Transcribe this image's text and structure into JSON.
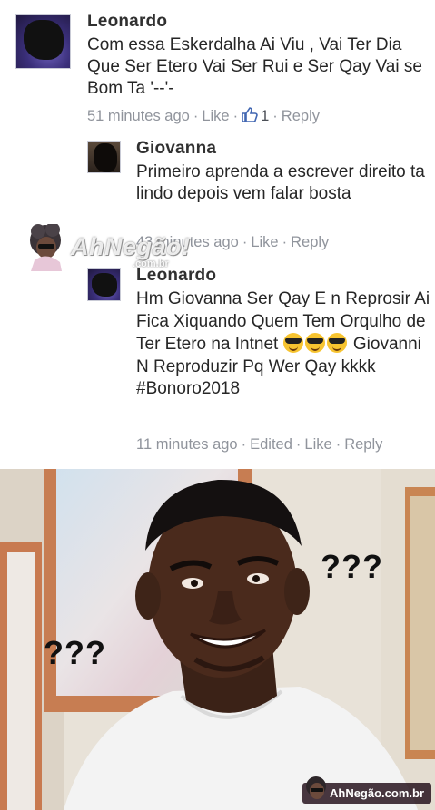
{
  "comments": [
    {
      "author": "Leonardo",
      "text": "Com essa Eskerdalha Ai Viu , Vai Ter Dia Que Ser Etero Vai Ser Rui e Ser Qay Vai se Bom Ta '--'-",
      "time": "51 minutes ago",
      "like_label": "Like",
      "like_count": "1",
      "reply_label": "Reply"
    },
    {
      "author": "Giovanna",
      "text": "Primeiro aprenda a escrever direito ta lindo depois vem falar bosta",
      "time": "43 minutes ago",
      "like_label": "Like",
      "reply_label": "Reply"
    },
    {
      "author": "Leonardo",
      "text_before_emoji": "Hm Giovanna Ser Qay E n Reprosir Ai Fica Xiquando Quem Tem Orqulho de Ter Etero na Intnet",
      "text_after_emoji": "Giovanni N Reproduzir Pq Wer Qay kkkk #Bonoro2018",
      "time": "11 minutes ago",
      "edited_label": "Edited",
      "like_label": "Like",
      "reply_label": "Reply"
    }
  ],
  "watermark": {
    "brand": "AhNegão!",
    "domain": ".com.br",
    "footer": "AhNegão.com.br"
  },
  "meme": {
    "question_left": "???",
    "question_right": "???"
  },
  "colors": {
    "meta_gray": "#90949c",
    "like_blue": "#4267b2",
    "name": "#303030"
  },
  "icons": [
    "thumbs-up-icon",
    "cool-emoji-icon",
    "watermark-mascot-icon"
  ]
}
